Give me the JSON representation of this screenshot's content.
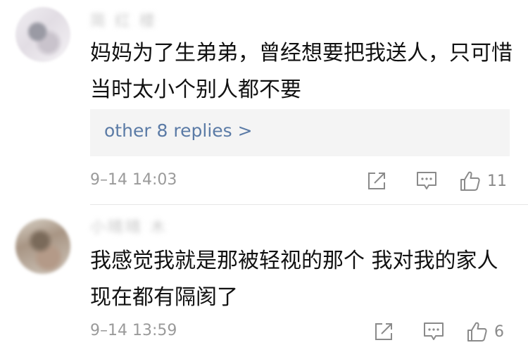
{
  "comments": [
    {
      "username": "简 红 楼",
      "text": "妈妈为了生弟弟，曾经想要把我送人，只可惜当时太小个别人都不要",
      "replies_link": "other 8 replies >",
      "time": "9–14 14:03",
      "likes": "11"
    },
    {
      "username": "小晴晴 木",
      "text": "我感觉我就是那被轻视的那个 我对我的家人现在都有隔阂了",
      "time": "9–14 13:59",
      "likes": "6"
    }
  ],
  "icons": {
    "share": "share-icon",
    "comment": "comment-icon",
    "like": "thumbs-up-icon"
  },
  "colors": {
    "link": "#5b7ba6",
    "meta": "#9a9a9a",
    "text": "#111111",
    "reply_bg": "#f4f4f4"
  }
}
